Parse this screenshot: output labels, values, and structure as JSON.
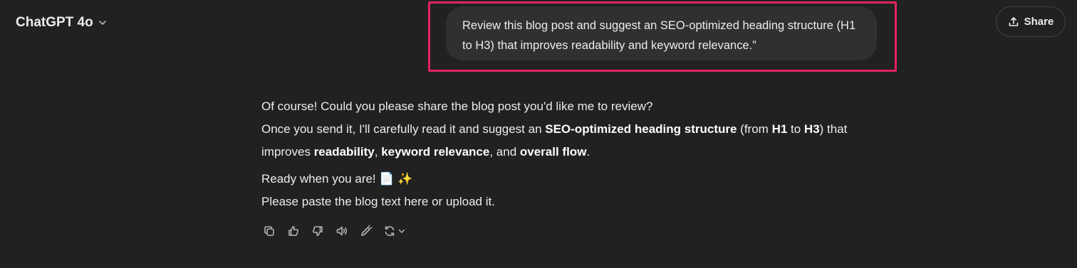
{
  "header": {
    "model_name": "ChatGPT 4o",
    "share_label": "Share"
  },
  "user_message": {
    "text": "Review this blog post and suggest an SEO-optimized heading structure (H1 to H3) that improves readability and keyword relevance.”"
  },
  "assistant_message": {
    "line1": "Of course! Could you please share the blog post you'd like me to review?",
    "line2": {
      "t1": "Once you send it, I'll carefully read it and suggest an ",
      "b1": "SEO-optimized heading structure",
      "t2": " (from ",
      "b2": "H1",
      "t3": " to ",
      "b3": "H3",
      "t4": ") that"
    },
    "line3": {
      "t1": "improves ",
      "b1": "readability",
      "t2": ", ",
      "b2": "keyword relevance",
      "t3": ", and ",
      "b3": "overall flow",
      "t4": "."
    },
    "line4": "Ready when you are! 📄 ✨",
    "line5": "Please paste the blog text here or upload it."
  },
  "icons": {
    "model_dropdown": "chevron-down-icon",
    "share": "share-icon",
    "actions": [
      "copy-icon",
      "thumbs-up-icon",
      "thumbs-down-icon",
      "read-aloud-icon",
      "edit-canvas-icon",
      "regenerate-icon"
    ]
  },
  "colors": {
    "background": "#212121",
    "bubble": "#303030",
    "highlight": "#e0245e",
    "text": "#ececec"
  }
}
